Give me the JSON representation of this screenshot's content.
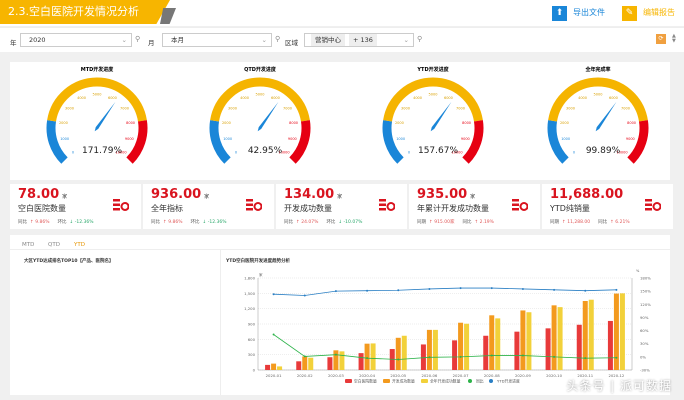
{
  "header": {
    "title": "2.3.空白医院开发情况分析",
    "export_label": "导出文件",
    "edit_label": "编辑报告"
  },
  "filters": {
    "year_label": "年",
    "year_value": "2020",
    "month_label": "月",
    "month_value": "本月",
    "region_label": "区域",
    "region_chip": "营销中心",
    "region_more": "+ 136"
  },
  "colors": {
    "accent": "#f7b500",
    "blue": "#1a86d8",
    "yellow": "#f5b400",
    "red": "#e60012",
    "kpi_red": "#d9141f"
  },
  "gauges": [
    {
      "title": "MTD开发进度",
      "value": "171.79%",
      "needle_value": 6300
    },
    {
      "title": "QTD开发进度",
      "value": "42.95%",
      "needle_value": 6300
    },
    {
      "title": "YTD开发进度",
      "value": "157.67%",
      "needle_value": 6300
    },
    {
      "title": "全年完成率",
      "value": "99.89%",
      "needle_value": 6300
    }
  ],
  "gauge_scale": {
    "min": 0,
    "max": 10000,
    "ticks": [
      "0",
      "1000",
      "2000",
      "3000",
      "4000",
      "5000",
      "6000",
      "7000",
      "8000",
      "9000",
      "10000"
    ],
    "bands": [
      [
        0,
        2000,
        "#1a86d8"
      ],
      [
        2000,
        8000,
        "#f5b400"
      ],
      [
        8000,
        10000,
        "#e60012"
      ]
    ]
  },
  "kpis": [
    {
      "value": "78.00",
      "unit": "家",
      "label": "空白医院数量",
      "s1_label": "同比",
      "s1_value": "↑ 9.86%",
      "s1_dir": "up",
      "s2_label": "环比",
      "s2_value": "↓ -12.36%",
      "s2_dir": "dn"
    },
    {
      "value": "936.00",
      "unit": "家",
      "label": "全年指标",
      "s1_label": "同比",
      "s1_value": "↑ 9.86%",
      "s1_dir": "up",
      "s2_label": "环比",
      "s2_value": "↓ -12.36%",
      "s2_dir": "dn"
    },
    {
      "value": "134.00",
      "unit": "家",
      "label": "开发成功数量",
      "s1_label": "同比",
      "s1_value": "↑ 24.07%",
      "s1_dir": "up",
      "s2_label": "环比",
      "s2_value": "↓ -10.07%",
      "s2_dir": "dn"
    },
    {
      "value": "935.00",
      "unit": "家",
      "label": "年累计开发成功数量",
      "s1_label": "同期",
      "s1_value": "↑ 915.00家",
      "s1_dir": "up",
      "s2_label": "同比",
      "s2_value": "↑ 2.19%",
      "s2_dir": "up"
    },
    {
      "value": "11,688.00",
      "unit": "",
      "label": "YTD纯销量",
      "s1_label": "同期",
      "s1_value": "↑ 11,288.00",
      "s1_dir": "up",
      "s2_label": "同比",
      "s2_value": "↑ 6.21%",
      "s2_dir": "up"
    }
  ],
  "tabs": [
    {
      "label": "MTD"
    },
    {
      "label": "QTD"
    },
    {
      "label": "YTD",
      "active": true
    }
  ],
  "left_panel": {
    "title": "大区YTD达成排名TOP10【产品、医院名】"
  },
  "chart_data": {
    "type": "bar+line",
    "title": "YTD空白医院开发进度趋势分析",
    "categories": [
      "2020-01",
      "2020-02",
      "2020-03",
      "2020-04",
      "2020-05",
      "2020-06",
      "2020-07",
      "2020-08",
      "2020-09",
      "2020-10",
      "2020-11",
      "2020-12"
    ],
    "y_left": {
      "unit": "家",
      "ylim": [
        0,
        1800
      ],
      "ticks": [
        "0",
        "300",
        "600",
        "900",
        "1,200",
        "1,500",
        "1,800"
      ]
    },
    "y_right": {
      "unit": "%",
      "ylim": [
        -30,
        180
      ],
      "ticks": [
        "-30%",
        "0%",
        "30%",
        "60%",
        "90%",
        "120%",
        "150%",
        "180%"
      ]
    },
    "grid": true,
    "legend": "bottom",
    "series": [
      {
        "name": "空白医院数量",
        "type": "bar",
        "color": "#e83a3a",
        "values": [
          100,
          170,
          250,
          330,
          410,
          500,
          580,
          670,
          750,
          815,
          885,
          960
        ]
      },
      {
        "name": "开发成功数量",
        "type": "bar",
        "color": "#f39a1e",
        "values": [
          125,
          265,
          385,
          515,
          630,
          785,
          925,
          1070,
          1165,
          1265,
          1350,
          1495
        ]
      },
      {
        "name": "全年开发成功数量",
        "type": "bar",
        "color": "#f2d13a",
        "values": [
          70,
          240,
          365,
          520,
          670,
          785,
          905,
          1010,
          1130,
          1230,
          1375,
          1500
        ]
      },
      {
        "name": "同比",
        "type": "line",
        "axis": "right",
        "color": "#2db34a",
        "values": [
          51,
          1,
          5,
          -3,
          -6,
          -1,
          0,
          3,
          3,
          0,
          -3,
          -2
        ]
      },
      {
        "name": "YTD开发进度",
        "type": "line",
        "axis": "right",
        "color": "#2a7fc4",
        "values": [
          143,
          140,
          150,
          151,
          152,
          155,
          157,
          157,
          155,
          153,
          151,
          153
        ]
      }
    ]
  },
  "watermark": "头条号 | 派可数据"
}
